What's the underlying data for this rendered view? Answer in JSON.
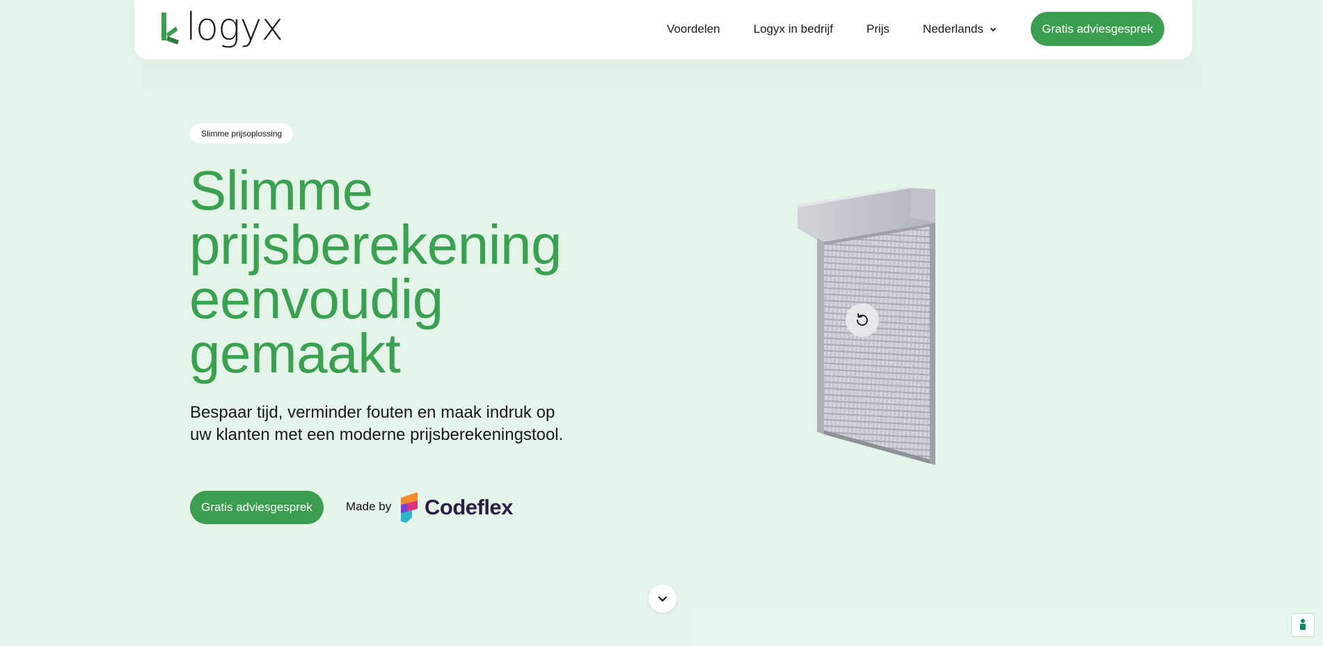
{
  "header": {
    "logo_text": "logyx",
    "nav": [
      {
        "label": "Voordelen"
      },
      {
        "label": "Logyx in bedrijf"
      },
      {
        "label": "Prijs"
      },
      {
        "label": "Nederlands"
      }
    ],
    "cta_label": "Gratis adviesgesprek"
  },
  "hero": {
    "badge": "Slimme prijsoplossing",
    "title_lines": [
      "Slimme",
      "prijsberekening",
      "eenvoudig",
      "gemaakt"
    ],
    "subtitle": "Bespaar tijd, verminder fouten en maak indruk op uw klanten met een moderne prijsberekeningstool.",
    "cta_label": "Gratis adviesgesprek",
    "made_by_label": "Made by",
    "partner_logo_text": "Codeflex"
  },
  "icons": {
    "rotate": "rotate-icon",
    "scroll_down": "chevron-down-icon",
    "cookie": "cookie-settings-icon",
    "language_chevron": "chevron-down-icon"
  },
  "colors": {
    "brand_green": "#3b9e4f",
    "title_green": "#3aa150",
    "background": "#e4f4e8",
    "codeflex_dark": "#2a1d46"
  }
}
